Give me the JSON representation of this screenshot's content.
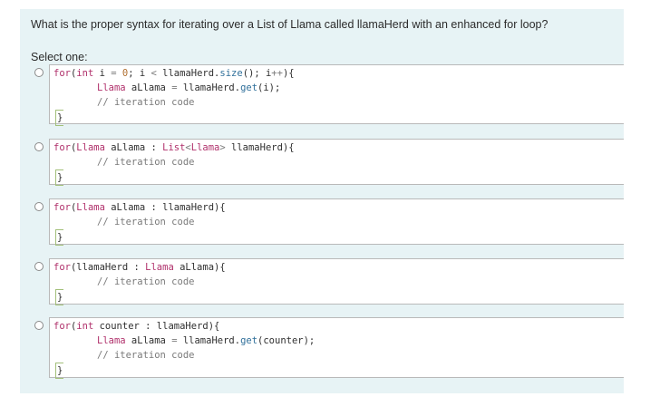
{
  "question": {
    "text": "What is the proper syntax for iterating over a List of Llama called llamaHerd with an enhanced for loop?",
    "select_label": "Select one:"
  },
  "options": [
    {
      "lines": [
        [
          [
            "kw",
            "for"
          ],
          [
            "pl",
            "("
          ],
          [
            "kw",
            "int"
          ],
          [
            "pl",
            " i "
          ],
          [
            "op",
            "="
          ],
          [
            "pl",
            " "
          ],
          [
            "nu",
            "0"
          ],
          [
            "pl",
            "; i "
          ],
          [
            "op",
            "<"
          ],
          [
            "pl",
            " llamaHerd."
          ],
          [
            "fn",
            "size"
          ],
          [
            "pl",
            "(); i"
          ],
          [
            "op",
            "++"
          ],
          [
            "pl",
            "){"
          ]
        ],
        [
          [
            "ty",
            "Llama"
          ],
          [
            "pl",
            " aLlama "
          ],
          [
            "op",
            "="
          ],
          [
            "pl",
            " llamaHerd."
          ],
          [
            "fn",
            "get"
          ],
          [
            "pl",
            "(i);"
          ]
        ],
        [
          [
            "cm",
            "// iteration code"
          ]
        ],
        [
          [
            "pl",
            "}"
          ]
        ]
      ]
    },
    {
      "lines": [
        [
          [
            "kw",
            "for"
          ],
          [
            "pl",
            "("
          ],
          [
            "ty",
            "Llama"
          ],
          [
            "pl",
            " aLlama : "
          ],
          [
            "ty",
            "List"
          ],
          [
            "op",
            "<"
          ],
          [
            "ty",
            "Llama"
          ],
          [
            "op",
            ">"
          ],
          [
            "pl",
            " llamaHerd){"
          ]
        ],
        [
          [
            "cm",
            "// iteration code"
          ]
        ],
        [
          [
            "pl",
            "}"
          ]
        ]
      ]
    },
    {
      "lines": [
        [
          [
            "kw",
            "for"
          ],
          [
            "pl",
            "("
          ],
          [
            "ty",
            "Llama"
          ],
          [
            "pl",
            " aLlama : llamaHerd){"
          ]
        ],
        [
          [
            "cm",
            "// iteration code"
          ]
        ],
        [
          [
            "pl",
            "}"
          ]
        ]
      ]
    },
    {
      "lines": [
        [
          [
            "kw",
            "for"
          ],
          [
            "pl",
            "(llamaHerd : "
          ],
          [
            "ty",
            "Llama"
          ],
          [
            "pl",
            " aLlama){"
          ]
        ],
        [
          [
            "cm",
            "// iteration code"
          ]
        ],
        [
          [
            "pl",
            "}"
          ]
        ]
      ]
    },
    {
      "lines": [
        [
          [
            "kw",
            "for"
          ],
          [
            "pl",
            "("
          ],
          [
            "kw",
            "int"
          ],
          [
            "pl",
            " counter : llamaHerd){"
          ]
        ],
        [
          [
            "ty",
            "Llama"
          ],
          [
            "pl",
            " aLlama "
          ],
          [
            "op",
            "="
          ],
          [
            "pl",
            " llamaHerd."
          ],
          [
            "fn",
            "get"
          ],
          [
            "pl",
            "(counter);"
          ]
        ],
        [
          [
            "cm",
            "// iteration code"
          ]
        ],
        [
          [
            "pl",
            "}"
          ]
        ]
      ]
    }
  ]
}
